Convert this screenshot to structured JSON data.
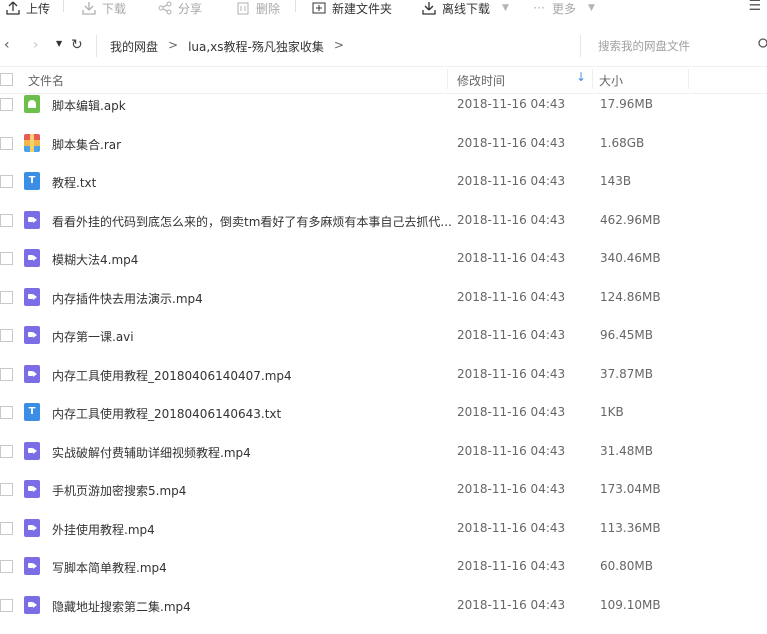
{
  "toolbar": {
    "upload": "上传",
    "download": "下载",
    "share": "分享",
    "delete": "删除",
    "new_folder": "新建文件夹",
    "offline_download": "离线下载",
    "more": "更多"
  },
  "nav": {
    "crumbs": [
      "我的网盘",
      ">",
      "lua,xs教程-殇凡独家收集",
      ">"
    ],
    "search_placeholder": "搜索我的网盘文件"
  },
  "columns": {
    "name": "文件名",
    "modified": "修改时间",
    "size": "大小"
  },
  "files": [
    {
      "name": "脚本编辑.apk",
      "time": "2018-11-16 04:43",
      "size": "17.96MB",
      "icon": "apk-icon"
    },
    {
      "name": "脚本集合.rar",
      "time": "2018-11-16 04:43",
      "size": "1.68GB",
      "icon": "rar-icon"
    },
    {
      "name": "教程.txt",
      "time": "2018-11-16 04:43",
      "size": "143B",
      "icon": "txt-icon"
    },
    {
      "name": "看看外挂的代码到底怎么来的，倒卖tm看好了有多麻烦有本事自己去抓代...",
      "time": "2018-11-16 04:43",
      "size": "462.96MB",
      "icon": "video-icon"
    },
    {
      "name": "模糊大法4.mp4",
      "time": "2018-11-16 04:43",
      "size": "340.46MB",
      "icon": "video-icon"
    },
    {
      "name": "内存插件快去用法演示.mp4",
      "time": "2018-11-16 04:43",
      "size": "124.86MB",
      "icon": "video-icon"
    },
    {
      "name": "内存第一课.avi",
      "time": "2018-11-16 04:43",
      "size": "96.45MB",
      "icon": "video-icon"
    },
    {
      "name": "内存工具使用教程_20180406140407.mp4",
      "time": "2018-11-16 04:43",
      "size": "37.87MB",
      "icon": "video-icon"
    },
    {
      "name": "内存工具使用教程_20180406140643.txt",
      "time": "2018-11-16 04:43",
      "size": "1KB",
      "icon": "txt-icon"
    },
    {
      "name": "实战破解付费辅助详细视频教程.mp4",
      "time": "2018-11-16 04:43",
      "size": "31.48MB",
      "icon": "video-icon"
    },
    {
      "name": "手机页游加密搜索5.mp4",
      "time": "2018-11-16 04:43",
      "size": "173.04MB",
      "icon": "video-icon"
    },
    {
      "name": "外挂使用教程.mp4",
      "time": "2018-11-16 04:43",
      "size": "113.36MB",
      "icon": "video-icon"
    },
    {
      "name": "写脚本简单教程.mp4",
      "time": "2018-11-16 04:43",
      "size": "60.80MB",
      "icon": "video-icon"
    },
    {
      "name": "隐藏地址搜索第二集.mp4",
      "time": "2018-11-16 04:43",
      "size": "109.10MB",
      "icon": "video-icon"
    }
  ],
  "colors": {
    "accent": "#4a90e2",
    "video": "#7b6de6",
    "txt": "#3a8ee6",
    "apk": "#6cbf4a"
  }
}
